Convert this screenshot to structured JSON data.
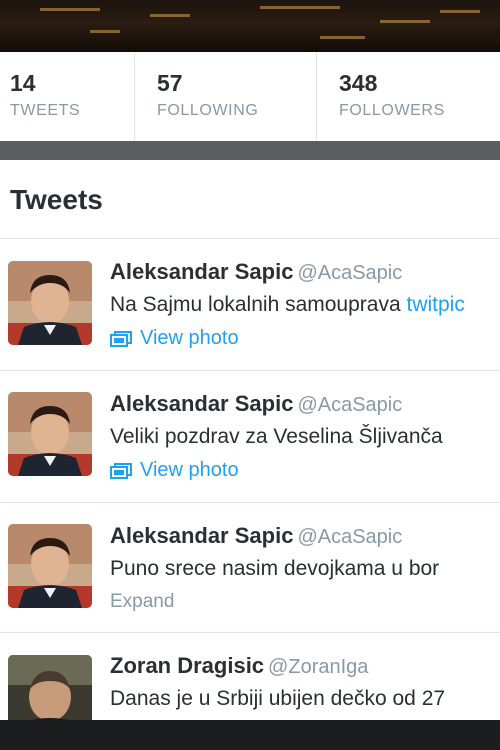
{
  "stats": [
    {
      "value": "14",
      "label": "TWEETS"
    },
    {
      "value": "57",
      "label": "FOLLOWING"
    },
    {
      "value": "348",
      "label": "FOLLOWERS"
    }
  ],
  "section_title": "Tweets",
  "tweets": [
    {
      "name": "Aleksandar Sapic",
      "handle": "@AcaSapic",
      "text": "Na Sajmu lokalnih samouprava ",
      "link": "twitpic",
      "action": "View photo"
    },
    {
      "name": "Aleksandar Sapic",
      "handle": "@AcaSapic",
      "text": "Veliki pozdrav za Veselina Šljivanča",
      "action": "View photo"
    },
    {
      "name": "Aleksandar Sapic",
      "handle": "@AcaSapic",
      "text": "Puno srece nasim devojkama u bor",
      "action": "Expand"
    },
    {
      "name": "Zoran Dragisic",
      "handle": "@ZoranIga",
      "text": "Danas je u Srbiji ubijen dečko od 27"
    }
  ],
  "colors": {
    "link": "#1da1f2",
    "muted": "#8899a6",
    "text": "#292f33"
  },
  "icons": {
    "photo": "photo-stack-icon"
  }
}
